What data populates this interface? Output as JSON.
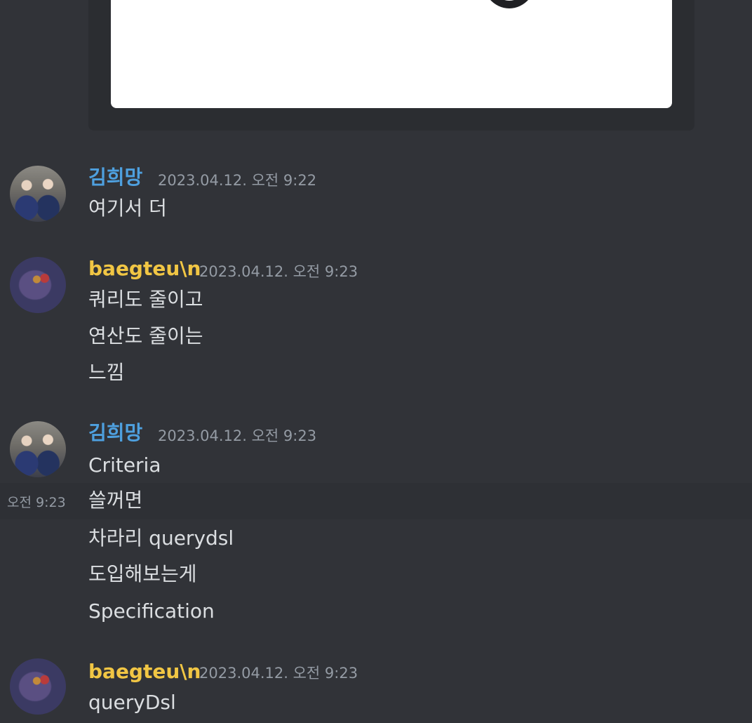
{
  "groups": [
    {
      "author": "김희망",
      "timestamp": "2023.04.12. 오전 9:22",
      "messages": [
        "여기서 더"
      ]
    },
    {
      "author": "baegteu\\n",
      "timestamp": "2023.04.12. 오전 9:23",
      "messages": [
        "쿼리도 줄이고",
        "연산도 줄이는",
        "느낌"
      ]
    },
    {
      "author": "김희망",
      "timestamp": "2023.04.12. 오전 9:23",
      "messages": [
        "Criteria",
        "쓸꺼면",
        "차라리 querydsl",
        "도입해보는게",
        "Specification"
      ]
    },
    {
      "author": "baegteu\\n",
      "timestamp": "2023.04.12. 오전 9:23",
      "messages": [
        "queryDsl"
      ]
    }
  ],
  "hover_time": "오전 9:23",
  "colors": {
    "background": "#313338",
    "embed": "#2b2d31",
    "author_kim": "#4ea0df",
    "author_baeg": "#f1c644",
    "timestamp": "#949ba4",
    "text": "#dbdee1"
  }
}
